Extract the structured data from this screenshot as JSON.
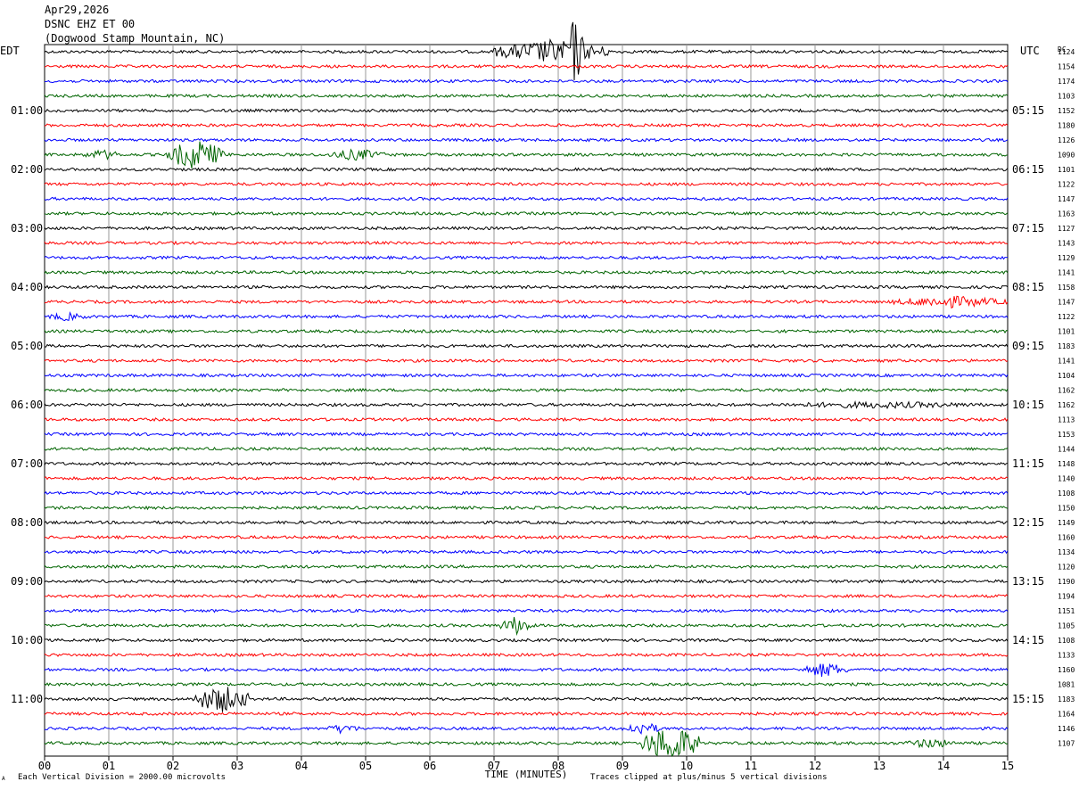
{
  "header": {
    "date": "Apr29,2026",
    "station": "DSNC EHZ ET 00",
    "location": "(Dogwood Stamp Mountain, NC)"
  },
  "left_timezone": "EDT",
  "right_timezone": "UTC",
  "dc_label": "DC",
  "footer": {
    "scale_note": "Each Vertical Division = 2000.00 microvolts",
    "clip_note": "Traces clipped at plus/minus 5 vertical divisions",
    "corner_mark": "A"
  },
  "chart_data": {
    "type": "line",
    "xlabel": "TIME (MINUTES)",
    "xlim": [
      0,
      15
    ],
    "x_ticks": [
      "00",
      "01",
      "02",
      "03",
      "04",
      "05",
      "06",
      "07",
      "08",
      "09",
      "10",
      "11",
      "12",
      "13",
      "14",
      "15"
    ],
    "rows_per_hour": 4,
    "trace_colors": [
      "#000000",
      "#ff0000",
      "#0000ff",
      "#006400"
    ],
    "left_hour_labels": [
      "01:00",
      "02:00",
      "03:00",
      "04:00",
      "05:00",
      "06:00",
      "07:00",
      "08:00",
      "09:00",
      "10:00",
      "11:00"
    ],
    "right_hour_labels": [
      "05:15",
      "06:15",
      "07:15",
      "08:15",
      "09:15",
      "10:15",
      "11:15",
      "12:15",
      "13:15",
      "14:15",
      "15:15"
    ],
    "dc_offsets": [
      "1124",
      "1154",
      "1174",
      "1103",
      "1152",
      "1180",
      "1126",
      "1090",
      "1101",
      "1122",
      "1147",
      "1163",
      "1127",
      "1143",
      "1129",
      "1141",
      "1158",
      "1147",
      "1122",
      "1101",
      "1183",
      "1141",
      "1104",
      "1162",
      "1162",
      "1113",
      "1153",
      "1144",
      "1148",
      "1140",
      "1108",
      "1150",
      "1149",
      "1160",
      "1134",
      "1120",
      "1190",
      "1194",
      "1151",
      "1105",
      "1108",
      "1133",
      "1160",
      "1081",
      "1183",
      "1164",
      "1146",
      "1107"
    ],
    "events": [
      {
        "row": 0,
        "start": 7.0,
        "end": 8.8,
        "amp": 14
      },
      {
        "row": 0,
        "start": 8.1,
        "end": 8.4,
        "amp": 40
      },
      {
        "row": 7,
        "start": 0.6,
        "end": 1.2,
        "amp": 6
      },
      {
        "row": 7,
        "start": 1.9,
        "end": 2.8,
        "amp": 18
      },
      {
        "row": 7,
        "start": 4.4,
        "end": 5.3,
        "amp": 7
      },
      {
        "row": 17,
        "start": 13.2,
        "end": 15,
        "amp": 7
      },
      {
        "row": 18,
        "start": 0,
        "end": 0.7,
        "amp": 5
      },
      {
        "row": 24,
        "start": 11.0,
        "end": 15,
        "amp": 4
      },
      {
        "row": 39,
        "start": 7.1,
        "end": 7.6,
        "amp": 11
      },
      {
        "row": 42,
        "start": 11.8,
        "end": 12.5,
        "amp": 9
      },
      {
        "row": 44,
        "start": 2.3,
        "end": 3.2,
        "amp": 16
      },
      {
        "row": 46,
        "start": 9.0,
        "end": 9.6,
        "amp": 8
      },
      {
        "row": 46,
        "start": 4.4,
        "end": 4.9,
        "amp": 6
      },
      {
        "row": 47,
        "start": 9.3,
        "end": 10.2,
        "amp": 22
      },
      {
        "row": 47,
        "start": 13.4,
        "end": 14.2,
        "amp": 6
      }
    ]
  }
}
